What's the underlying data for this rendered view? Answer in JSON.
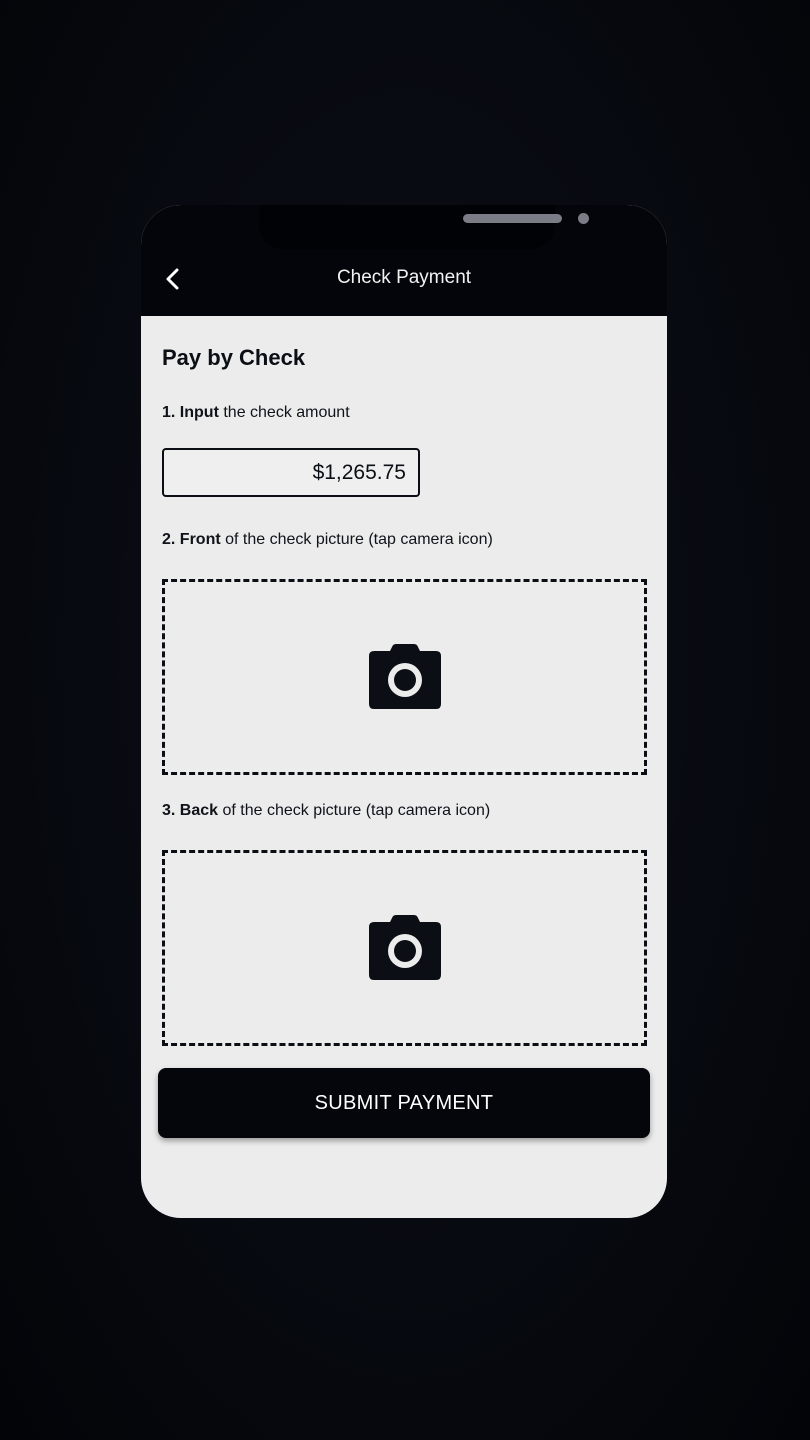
{
  "header": {
    "title": "Check Payment",
    "back_icon": "chevron-left-icon"
  },
  "main": {
    "heading": "Pay by Check",
    "step1": {
      "number": "1.",
      "emphasis": "Input",
      "text": "the check amount"
    },
    "amount_value": "$1,265.75",
    "step2": {
      "number": "2.",
      "emphasis": "Front",
      "text": "of the check picture (tap camera icon)"
    },
    "step3": {
      "number": "3.",
      "emphasis": "Back",
      "text": "of the check picture (tap camera icon)"
    },
    "camera_icon": "camera-icon",
    "submit_label": "SUBMIT PAYMENT"
  },
  "colors": {
    "dark": "#03050a",
    "screen_bg": "#ececec",
    "accent_text": "#ffffff"
  }
}
